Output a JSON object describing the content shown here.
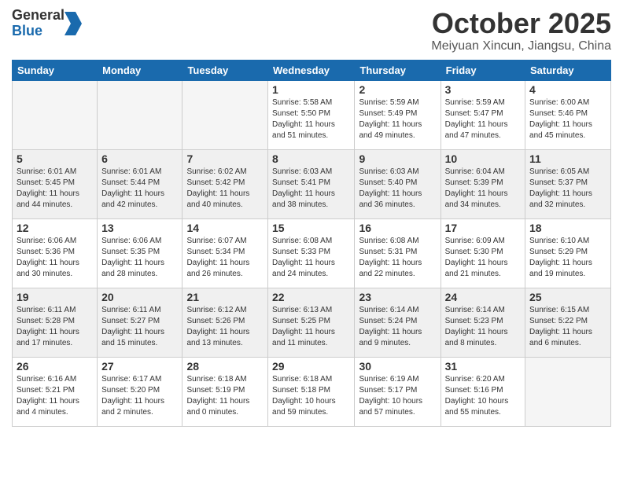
{
  "header": {
    "logo_general": "General",
    "logo_blue": "Blue",
    "month_title": "October 2025",
    "location": "Meiyuan Xincun, Jiangsu, China"
  },
  "weekdays": [
    "Sunday",
    "Monday",
    "Tuesday",
    "Wednesday",
    "Thursday",
    "Friday",
    "Saturday"
  ],
  "weeks": [
    {
      "shaded": false,
      "days": [
        {
          "num": "",
          "info": ""
        },
        {
          "num": "",
          "info": ""
        },
        {
          "num": "",
          "info": ""
        },
        {
          "num": "1",
          "info": "Sunrise: 5:58 AM\nSunset: 5:50 PM\nDaylight: 11 hours\nand 51 minutes."
        },
        {
          "num": "2",
          "info": "Sunrise: 5:59 AM\nSunset: 5:49 PM\nDaylight: 11 hours\nand 49 minutes."
        },
        {
          "num": "3",
          "info": "Sunrise: 5:59 AM\nSunset: 5:47 PM\nDaylight: 11 hours\nand 47 minutes."
        },
        {
          "num": "4",
          "info": "Sunrise: 6:00 AM\nSunset: 5:46 PM\nDaylight: 11 hours\nand 45 minutes."
        }
      ]
    },
    {
      "shaded": true,
      "days": [
        {
          "num": "5",
          "info": "Sunrise: 6:01 AM\nSunset: 5:45 PM\nDaylight: 11 hours\nand 44 minutes."
        },
        {
          "num": "6",
          "info": "Sunrise: 6:01 AM\nSunset: 5:44 PM\nDaylight: 11 hours\nand 42 minutes."
        },
        {
          "num": "7",
          "info": "Sunrise: 6:02 AM\nSunset: 5:42 PM\nDaylight: 11 hours\nand 40 minutes."
        },
        {
          "num": "8",
          "info": "Sunrise: 6:03 AM\nSunset: 5:41 PM\nDaylight: 11 hours\nand 38 minutes."
        },
        {
          "num": "9",
          "info": "Sunrise: 6:03 AM\nSunset: 5:40 PM\nDaylight: 11 hours\nand 36 minutes."
        },
        {
          "num": "10",
          "info": "Sunrise: 6:04 AM\nSunset: 5:39 PM\nDaylight: 11 hours\nand 34 minutes."
        },
        {
          "num": "11",
          "info": "Sunrise: 6:05 AM\nSunset: 5:37 PM\nDaylight: 11 hours\nand 32 minutes."
        }
      ]
    },
    {
      "shaded": false,
      "days": [
        {
          "num": "12",
          "info": "Sunrise: 6:06 AM\nSunset: 5:36 PM\nDaylight: 11 hours\nand 30 minutes."
        },
        {
          "num": "13",
          "info": "Sunrise: 6:06 AM\nSunset: 5:35 PM\nDaylight: 11 hours\nand 28 minutes."
        },
        {
          "num": "14",
          "info": "Sunrise: 6:07 AM\nSunset: 5:34 PM\nDaylight: 11 hours\nand 26 minutes."
        },
        {
          "num": "15",
          "info": "Sunrise: 6:08 AM\nSunset: 5:33 PM\nDaylight: 11 hours\nand 24 minutes."
        },
        {
          "num": "16",
          "info": "Sunrise: 6:08 AM\nSunset: 5:31 PM\nDaylight: 11 hours\nand 22 minutes."
        },
        {
          "num": "17",
          "info": "Sunrise: 6:09 AM\nSunset: 5:30 PM\nDaylight: 11 hours\nand 21 minutes."
        },
        {
          "num": "18",
          "info": "Sunrise: 6:10 AM\nSunset: 5:29 PM\nDaylight: 11 hours\nand 19 minutes."
        }
      ]
    },
    {
      "shaded": true,
      "days": [
        {
          "num": "19",
          "info": "Sunrise: 6:11 AM\nSunset: 5:28 PM\nDaylight: 11 hours\nand 17 minutes."
        },
        {
          "num": "20",
          "info": "Sunrise: 6:11 AM\nSunset: 5:27 PM\nDaylight: 11 hours\nand 15 minutes."
        },
        {
          "num": "21",
          "info": "Sunrise: 6:12 AM\nSunset: 5:26 PM\nDaylight: 11 hours\nand 13 minutes."
        },
        {
          "num": "22",
          "info": "Sunrise: 6:13 AM\nSunset: 5:25 PM\nDaylight: 11 hours\nand 11 minutes."
        },
        {
          "num": "23",
          "info": "Sunrise: 6:14 AM\nSunset: 5:24 PM\nDaylight: 11 hours\nand 9 minutes."
        },
        {
          "num": "24",
          "info": "Sunrise: 6:14 AM\nSunset: 5:23 PM\nDaylight: 11 hours\nand 8 minutes."
        },
        {
          "num": "25",
          "info": "Sunrise: 6:15 AM\nSunset: 5:22 PM\nDaylight: 11 hours\nand 6 minutes."
        }
      ]
    },
    {
      "shaded": false,
      "days": [
        {
          "num": "26",
          "info": "Sunrise: 6:16 AM\nSunset: 5:21 PM\nDaylight: 11 hours\nand 4 minutes."
        },
        {
          "num": "27",
          "info": "Sunrise: 6:17 AM\nSunset: 5:20 PM\nDaylight: 11 hours\nand 2 minutes."
        },
        {
          "num": "28",
          "info": "Sunrise: 6:18 AM\nSunset: 5:19 PM\nDaylight: 11 hours\nand 0 minutes."
        },
        {
          "num": "29",
          "info": "Sunrise: 6:18 AM\nSunset: 5:18 PM\nDaylight: 10 hours\nand 59 minutes."
        },
        {
          "num": "30",
          "info": "Sunrise: 6:19 AM\nSunset: 5:17 PM\nDaylight: 10 hours\nand 57 minutes."
        },
        {
          "num": "31",
          "info": "Sunrise: 6:20 AM\nSunset: 5:16 PM\nDaylight: 10 hours\nand 55 minutes."
        },
        {
          "num": "",
          "info": ""
        }
      ]
    }
  ]
}
